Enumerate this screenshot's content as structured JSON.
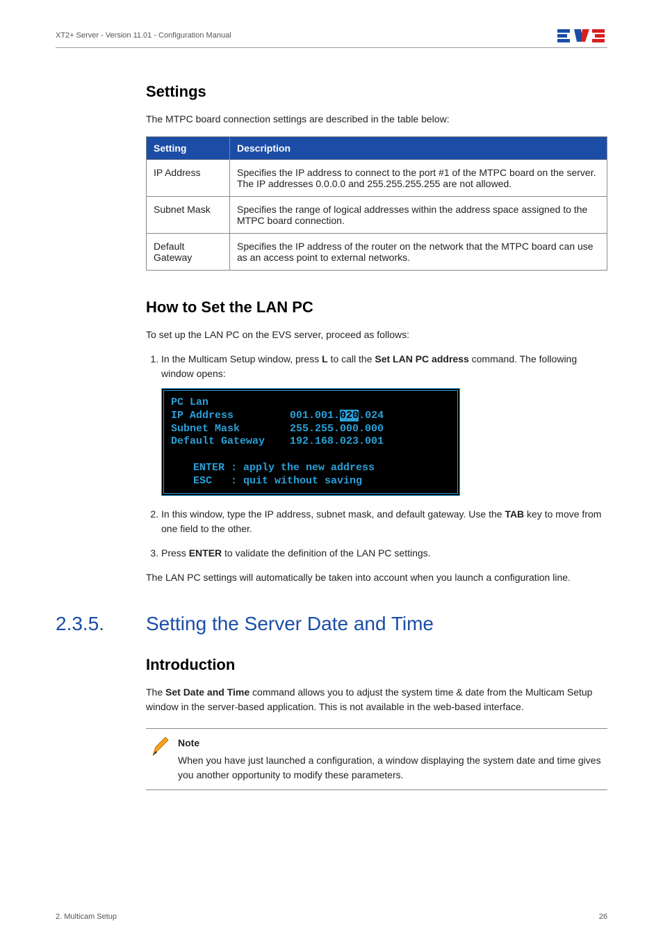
{
  "header": {
    "left": "XT2+ Server - Version 11.01 - Configuration Manual"
  },
  "settings": {
    "heading": "Settings",
    "intro": "The MTPC board connection settings are described in the table below:",
    "columns": {
      "c1": "Setting",
      "c2": "Description"
    },
    "rows": [
      {
        "name": "IP Address",
        "desc": "Specifies the IP address to connect to the port #1 of the MTPC board on the server. The IP addresses 0.0.0.0 and 255.255.255.255 are not allowed."
      },
      {
        "name": "Subnet Mask",
        "desc": "Specifies the range of logical addresses within the address space assigned to the MTPC board connection."
      },
      {
        "name": "Default Gateway",
        "desc": "Specifies the IP address of the router on the network that the MTPC board can use as an access point to external networks."
      }
    ]
  },
  "lanpc": {
    "heading": "How to Set the LAN PC",
    "intro": "To set up the LAN PC on the EVS server, proceed as follows:",
    "step1_a": "In the Multicam Setup window, press ",
    "step1_L": "L",
    "step1_b": " to call the ",
    "step1_cmd": "Set LAN PC address",
    "step1_c": " command. The following window opens:",
    "term": {
      "l1a": "PC Lan",
      "l2a": "IP Address         ",
      "l2b": "001.001.",
      "l2c": "020",
      "l2d": ".024",
      "l3a": "Subnet Mask        255.255.000.000",
      "l4a": "Default Gateway    192.168.023.001",
      "l5a": "ENTER : apply the new address",
      "l6a": "ESC   : quit without saving"
    },
    "step2_a": "In this window, type the IP address, subnet mask, and default gateway. Use the ",
    "step2_tab": "TAB",
    "step2_b": " key to move from one field to the other.",
    "step3_a": "Press ",
    "step3_enter": "ENTER",
    "step3_b": " to validate the definition of the LAN PC settings.",
    "closing": "The LAN PC settings will automatically be taken into account when you launch a configuration line."
  },
  "section": {
    "num": "2.3.5.",
    "title": "Setting the Server Date and Time",
    "intro_h": "Introduction",
    "intro_a": "The ",
    "intro_cmd": "Set Date and Time",
    "intro_b": " command allows you to adjust the system time & date from the Multicam Setup window in the server-based application. This is not available in the web-based interface.",
    "note_title": "Note",
    "note_body": "When you have just launched a configuration, a window displaying the system date and time gives you another opportunity to modify these parameters."
  },
  "footer": {
    "left": "2. Multicam Setup",
    "right": "26"
  }
}
